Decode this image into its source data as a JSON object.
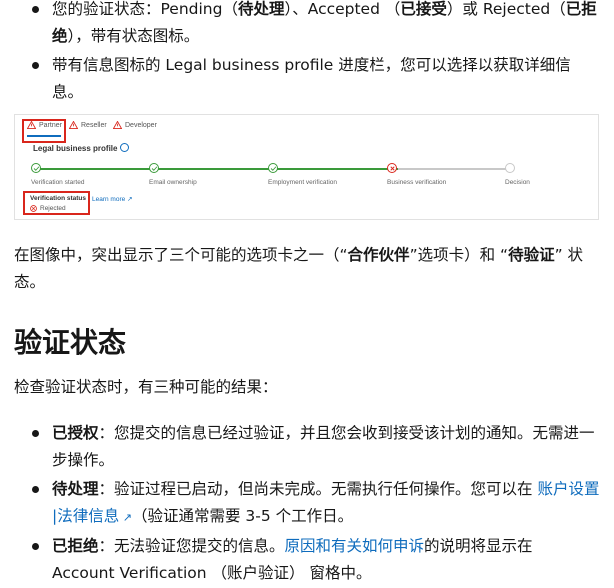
{
  "bullets_top": [
    {
      "bold_parts": [
        "您的验证状态：Pending（",
        "待处理",
        "）、Accepted （",
        "已接受",
        "）或 Rejected（",
        "已拒绝",
        "），带有状态图标。"
      ]
    },
    {
      "text": "带有信息图标的 Legal business profile 进度栏，您可以选择以获取详细信息。"
    }
  ],
  "screenshot": {
    "tabs": [
      "Partner",
      "Reseller",
      "Developer"
    ],
    "profile_title": "Legal business profile",
    "steps": [
      "Verification started",
      "Email ownership",
      "Employment verification",
      "Business verification",
      "Decision"
    ],
    "status_label": "Verification status",
    "status_value": "Rejected",
    "learn_more": "Learn more",
    "colors": {
      "done": "#3a9a3a",
      "error": "#d9261c",
      "pending": "#c8c8c8",
      "highlight": "#d9261c"
    }
  },
  "caption": {
    "p1": "在图像中，突出显示了三个可能的选项卡之一（“",
    "b1": "合作伙伴",
    "p2": "”选项卡）和 “",
    "b2": "待验证",
    "p3": "” 状态。"
  },
  "heading": "验证状态",
  "intro": "检查验证状态时，有三种可能的结果：",
  "results": [
    {
      "label": "已授权",
      "text": "：您提交的信息已经过验证，并且您会收到接受该计划的通知。无需进一步操作。"
    },
    {
      "label": "待处理",
      "text": "：验证过程已启动，但尚未完成。无需执行任何操作。您可以在 ",
      "link": "账户设置 |法律信息",
      "after": "（验证通常需要 3-5 个工作日。"
    },
    {
      "label": "已拒绝",
      "text": "：无法验证您提交的信息。",
      "link": "原因和有关如何申诉",
      "after": "的说明将显示在 ",
      "bold_tail": "Account Verification （账户验证）",
      "end": " 窗格中。"
    }
  ]
}
